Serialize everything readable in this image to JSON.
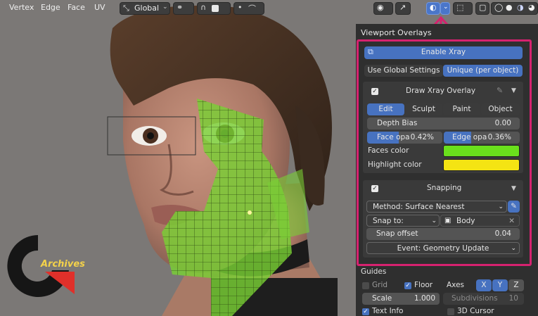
{
  "header": {
    "menus": [
      "Vertex",
      "Edge",
      "Face",
      "UV"
    ],
    "transform_orientation": "Global"
  },
  "panel": {
    "title": "Viewport Overlays",
    "enable_xray": "Enable Xray",
    "settings_tabs": [
      "Use Global Settings",
      "Unique (per object)"
    ],
    "xray_overlay": {
      "title": "Draw Xray Overlay",
      "modes": [
        "Edit",
        "Sculpt",
        "Paint",
        "Object"
      ],
      "depth_bias_label": "Depth Bias",
      "depth_bias_value": "0.00",
      "face_opa_label": "Face opa",
      "face_opa_value": "0.42%",
      "edge_opa_label": "Edge opa",
      "edge_opa_value": "0.36%",
      "faces_color_label": "Faces color",
      "faces_color": "#6ae01c",
      "highlight_color_label": "Highlight color",
      "highlight_color": "#f4e413"
    },
    "snapping": {
      "title": "Snapping",
      "method": "Method: Surface Nearest",
      "snap_to": "Snap to: Collecti...",
      "target": "Body",
      "offset_label": "Snap offset",
      "offset_value": "0.04",
      "event": "Event: Geometry Update"
    },
    "guides": {
      "title": "Guides",
      "grid": "Grid",
      "floor": "Floor",
      "axes": "Axes",
      "axis_x": "X",
      "axis_y": "Y",
      "axis_z": "Z",
      "scale_label": "Scale",
      "scale_value": "1.000",
      "subdivisions_label": "Subdivisions",
      "subdivisions_value": "10",
      "text_info": "Text Info",
      "cursor_3d": "3D Cursor"
    }
  },
  "watermark": {
    "text": "Archives"
  },
  "colors": {
    "accent": "#4772c0",
    "highlight_frame": "#d6226f",
    "mesh_green": "#7ed33a"
  }
}
